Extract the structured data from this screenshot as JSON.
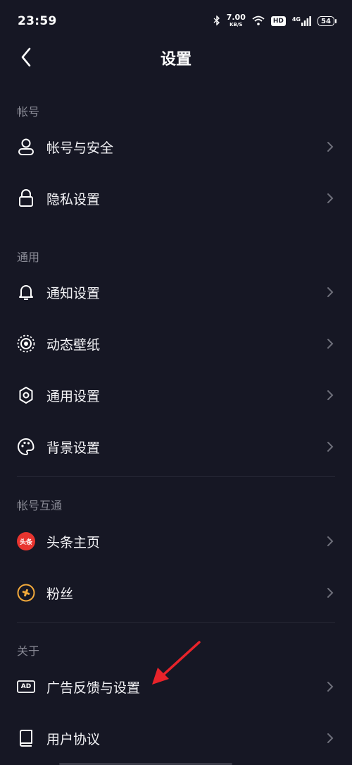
{
  "status_bar": {
    "time": "23:59",
    "net_speed_value": "7.00",
    "net_speed_unit": "KB/S",
    "hd": "HD",
    "network": "4G",
    "battery": "54"
  },
  "header": {
    "title": "设置"
  },
  "sections": {
    "account": {
      "label": "帐号",
      "items": [
        {
          "label": "帐号与安全",
          "icon": "person-icon"
        },
        {
          "label": "隐私设置",
          "icon": "lock-icon"
        }
      ]
    },
    "general": {
      "label": "通用",
      "items": [
        {
          "label": "通知设置",
          "icon": "bell-icon"
        },
        {
          "label": "动态壁纸",
          "icon": "live-wallpaper-icon"
        },
        {
          "label": "通用设置",
          "icon": "gear-icon"
        },
        {
          "label": "背景设置",
          "icon": "palette-icon"
        }
      ]
    },
    "linked": {
      "label": "帐号互通",
      "items": [
        {
          "label": "头条主页",
          "icon": "toutiao-logo-icon",
          "logo_text": "头条"
        },
        {
          "label": "粉丝",
          "icon": "fans-icon"
        }
      ]
    },
    "about": {
      "label": "关于",
      "items": [
        {
          "label": "广告反馈与设置",
          "icon": "ad-icon",
          "icon_text": "AD"
        },
        {
          "label": "用户协议",
          "icon": "book-icon"
        }
      ]
    }
  },
  "colors": {
    "background": "#161724",
    "text": "#f2f2f5",
    "section_label": "#8a8b96",
    "chevron": "#6e6f7a",
    "annotation_arrow": "#e8232a",
    "toutiao_red": "#e8342f",
    "fans_orange": "#f2a93b"
  }
}
